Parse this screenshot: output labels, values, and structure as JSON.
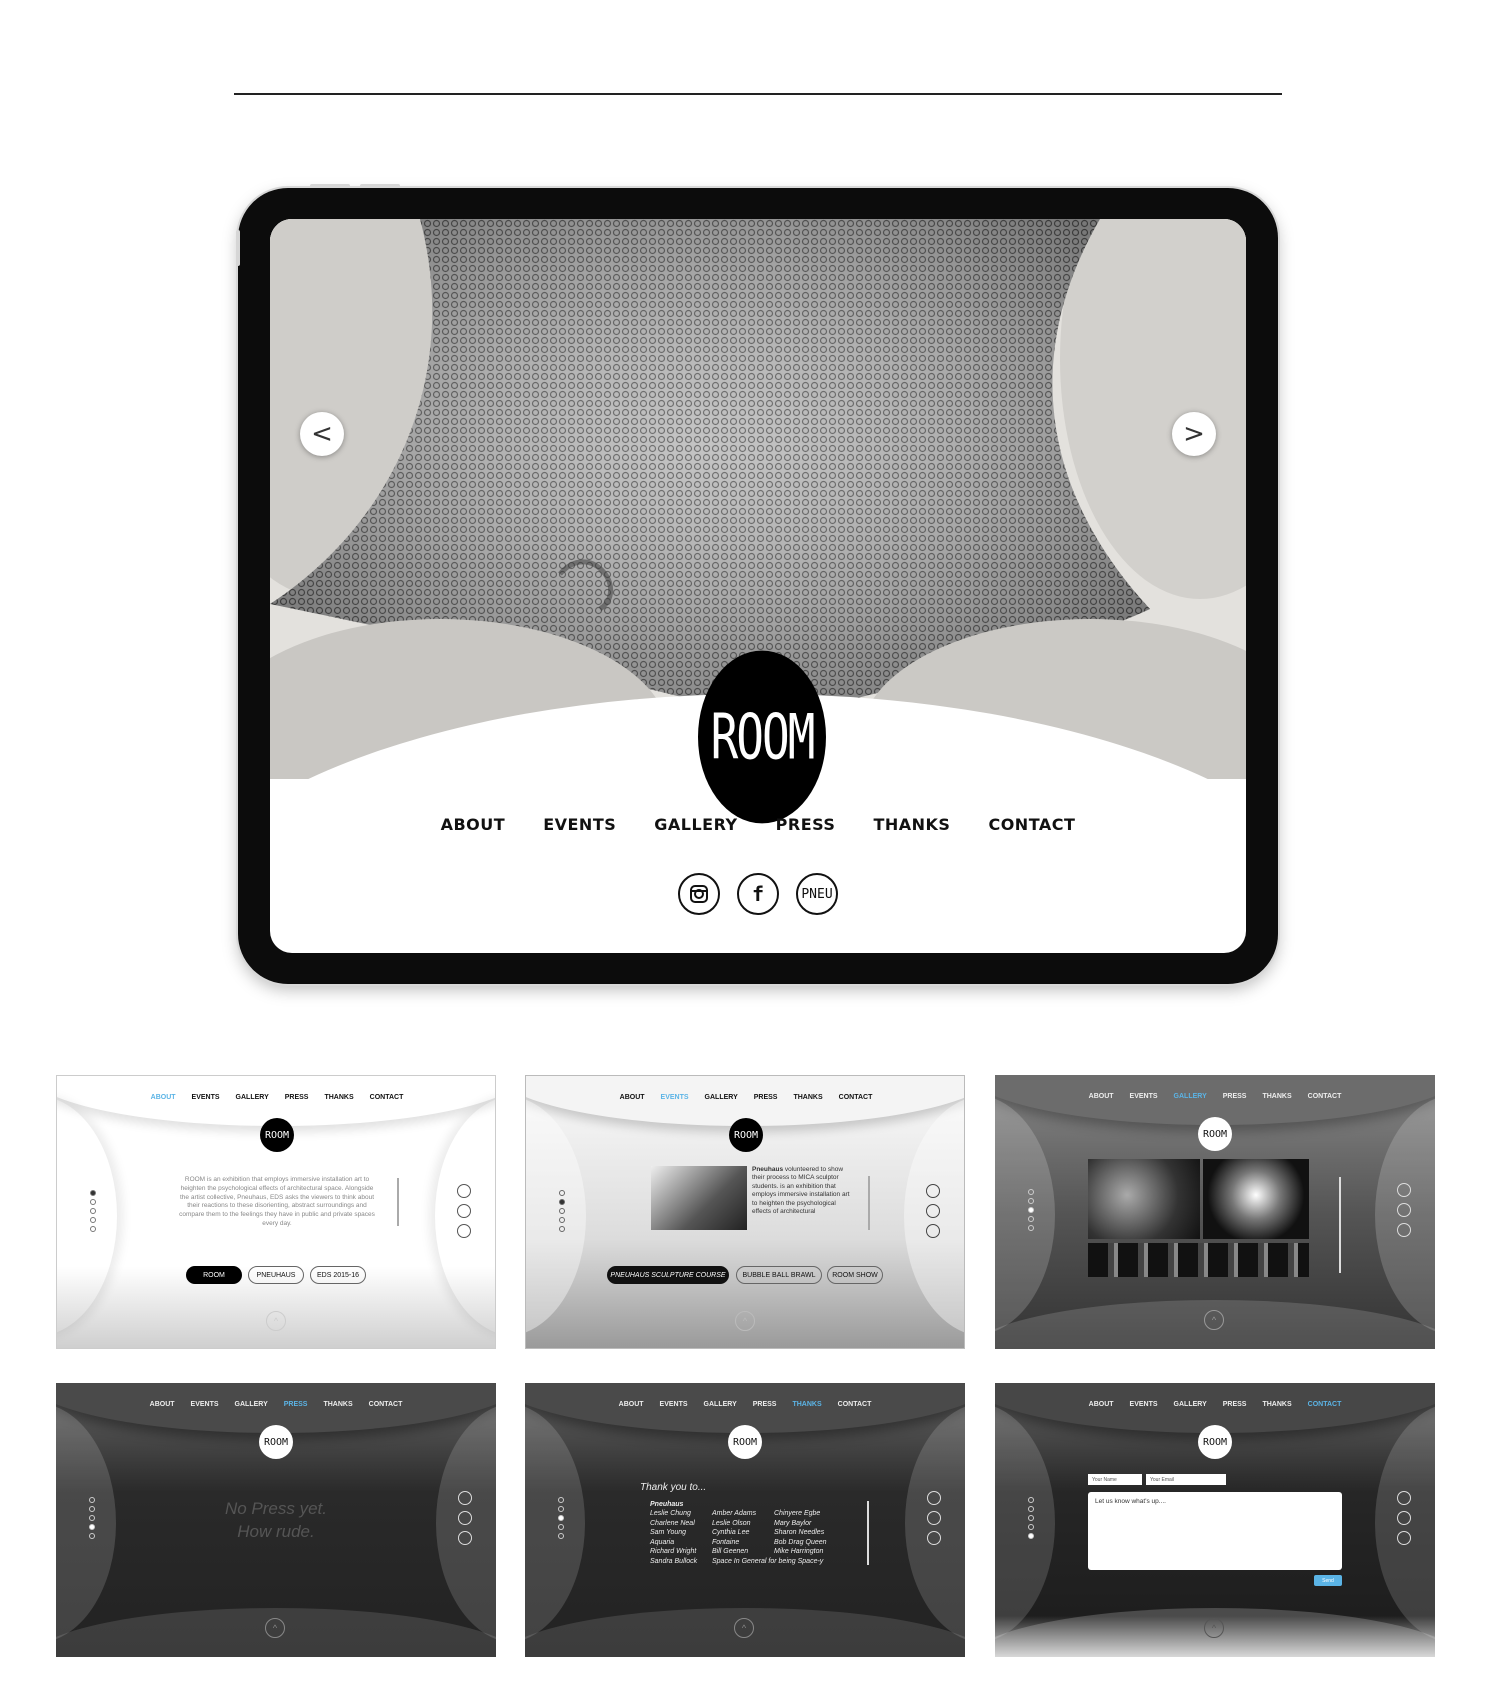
{
  "hero": {
    "logo": "ROOM",
    "prev_label": "<",
    "next_label": ">",
    "nav": [
      "ABOUT",
      "EVENTS",
      "GALLERY",
      "PRESS",
      "THANKS",
      "CONTACT"
    ],
    "social": {
      "instagram": "instagram-icon",
      "facebook": "f",
      "pneu": "PNEU"
    }
  },
  "thumbs": {
    "nav": [
      "ABOUT",
      "EVENTS",
      "GALLERY",
      "PRESS",
      "THANKS",
      "CONTACT"
    ],
    "logo": "ROOM",
    "about": {
      "text": "ROOM is an exhibition that employs immersive installation art to heighten the psychological effects of architectural space. Alongside the artist collective, Pneuhaus, EDS asks the viewers to think about their reactions to these disorienting, abstract surroundings and compare them to the feelings they have in public and private spaces every day.",
      "pills": [
        "ROOM",
        "PNEUHAUS",
        "EDS 2015-16"
      ]
    },
    "events": {
      "title": "Pneuhaus",
      "text": "volunteered to show their process to MICA sculptor students. is an exhibition that employs immersive installation art to heighten the psychological effects of architectural",
      "pills": [
        "PNEUHAUS SCULPTURE COURSE",
        "BUBBLE BALL BRAWL",
        "ROOM SHOW"
      ]
    },
    "press": {
      "line1": "No Press yet.",
      "line2": "How rude."
    },
    "thanks": {
      "heading": "Thank you to...",
      "col1": [
        "Pneuhaus",
        "Leslie Chung",
        "Charlene Neal",
        "Sam Young",
        "Aquaria",
        "Richard Wright",
        "Sandra Bullock"
      ],
      "col2": [
        "",
        "Amber Adams",
        "Leslie Olson",
        "Cynthia Lee",
        "Fontaine",
        "Bill Geenen",
        "Space In General for being Space-y"
      ],
      "col3": [
        "",
        "Chinyere Egbe",
        "Mary Baylor",
        "Sharon Needles",
        "Bob Drag Queen",
        "Mike Harrington",
        ""
      ]
    },
    "contact": {
      "name": "Your Name",
      "email": "Your Email",
      "message": "Let us know what's up....",
      "send": "Send"
    }
  },
  "colors": {
    "accent": "#5bb4e6",
    "dark": "#1c1c1c",
    "mid": "#555555"
  }
}
